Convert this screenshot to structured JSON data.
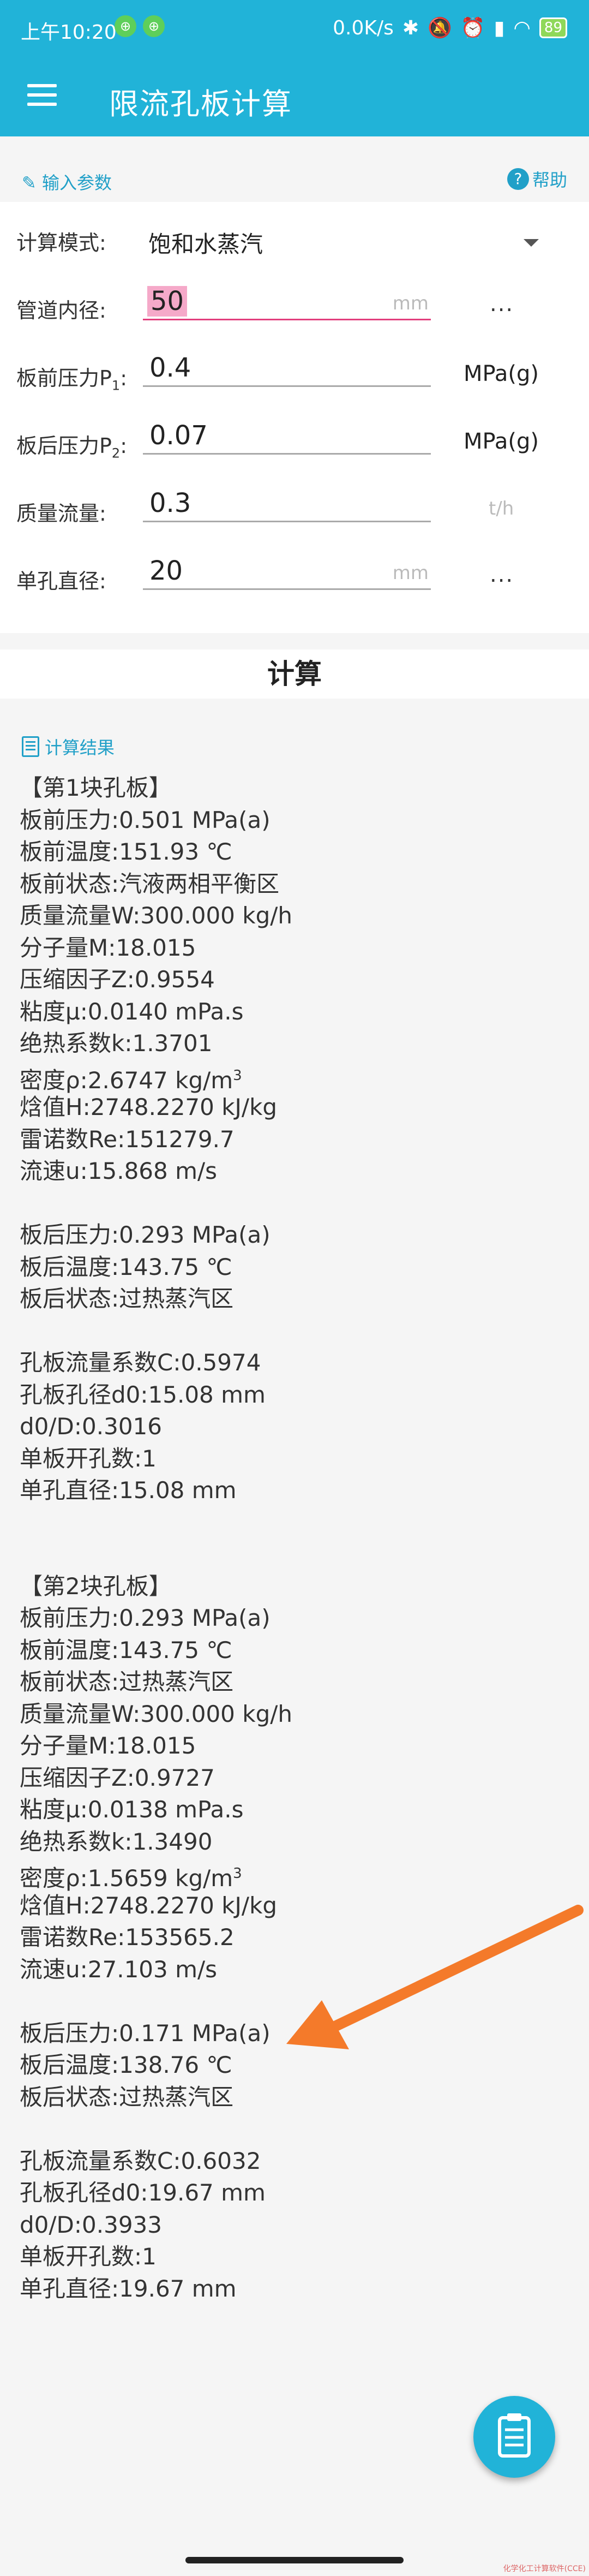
{
  "status": {
    "time": "上午10:20",
    "net_speed": "0.0K/s",
    "battery": "89",
    "notif1": "⊕",
    "notif2": "⊕",
    "icons": [
      "bluetooth-icon",
      "mute-icon",
      "alarm-icon",
      "signal-icon",
      "wifi-icon",
      "battery-icon"
    ]
  },
  "appbar": {
    "title": "限流孔板计算"
  },
  "input_section": {
    "label": "输入参数",
    "help": "帮助"
  },
  "form": {
    "mode_label": "计算模式:",
    "mode_value": "饱和水蒸汽",
    "pipe_label": "管道内径:",
    "pipe_value": "50",
    "pipe_unit": "mm",
    "p1_label": "板前压力P",
    "p1_sub": "1",
    "p1_value": "0.4",
    "p1_unit": "MPa(g)",
    "p2_label": "板后压力P",
    "p2_sub": "2",
    "p2_value": "0.07",
    "p2_unit": "MPa(g)",
    "flow_label": "质量流量:",
    "flow_value": "0.3",
    "flow_unit": "t/h",
    "hole_label": "单孔直径:",
    "hole_value": "20",
    "hole_unit": "mm",
    "more": "..."
  },
  "calc_button": "计算",
  "results": {
    "header": "计算结果",
    "lines": [
      "【第1块孔板】",
      "板前压力:0.501 MPa(a)",
      "板前温度:151.93 ℃",
      "板前状态:汽液两相平衡区",
      "质量流量W:300.000 kg/h",
      "分子量M:18.015",
      "压缩因子Z:0.9554",
      "粘度μ:0.0140 mPa.s",
      "绝热系数k:1.3701",
      "密度ρ:2.6747 kg/m",
      "焓值H:2748.2270 kJ/kg",
      "雷诺数Re:151279.7",
      "流速u:15.868 m/s",
      "",
      "板后压力:0.293 MPa(a)",
      "板后温度:143.75 ℃",
      "板后状态:过热蒸汽区",
      "",
      "孔板流量系数C:0.5974",
      "孔板孔径d0:15.08 mm",
      "d0/D:0.3016",
      "单板开孔数:1",
      "单孔直径:15.08 mm",
      "",
      "",
      "【第2块孔板】",
      "板前压力:0.293 MPa(a)",
      "板前温度:143.75 ℃",
      "板前状态:过热蒸汽区",
      "质量流量W:300.000 kg/h",
      "分子量M:18.015",
      "压缩因子Z:0.9727",
      "粘度μ:0.0138 mPa.s",
      "绝热系数k:1.3490",
      "密度ρ:1.5659 kg/m",
      "焓值H:2748.2270 kJ/kg",
      "雷诺数Re:153565.2",
      "流速u:27.103 m/s",
      "",
      "板后压力:0.171 MPa(a)",
      "板后温度:138.76 ℃",
      "板后状态:过热蒸汽区",
      "",
      "孔板流量系数C:0.6032",
      "孔板孔径d0:19.67 mm",
      "d0/D:0.3933",
      "单板开孔数:1",
      "单孔直径:19.67 mm"
    ],
    "density_sup": "3"
  },
  "watermark": "化学化工计算软件(CCE)",
  "colors": {
    "primary": "#21b3d8",
    "accent": "#e23e7d",
    "arrow": "#f47a2a"
  }
}
